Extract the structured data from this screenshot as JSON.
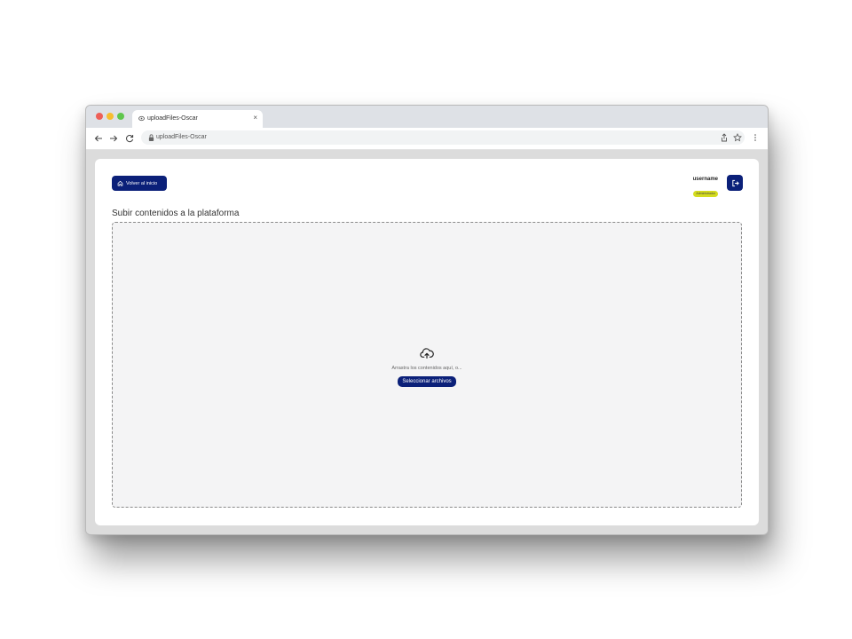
{
  "browser": {
    "tab_title": "uploadFiles-Oscar",
    "tab_close": "×",
    "url": "uploadFiles-Oscar"
  },
  "header": {
    "home_button_label": "Volver al inicio",
    "username": "username",
    "role": "Administrador"
  },
  "main": {
    "title": "Subir contenidos a la plataforma",
    "dropzone_text": "Arrastra los contenidos aquí, o...",
    "select_button_label": "Seleccionar archivos"
  },
  "colors": {
    "primary": "#0b2079",
    "badge": "#d4dc1e"
  },
  "icons": {
    "home": "home-icon",
    "logout": "logout-icon",
    "upload": "cloud-upload-icon"
  }
}
